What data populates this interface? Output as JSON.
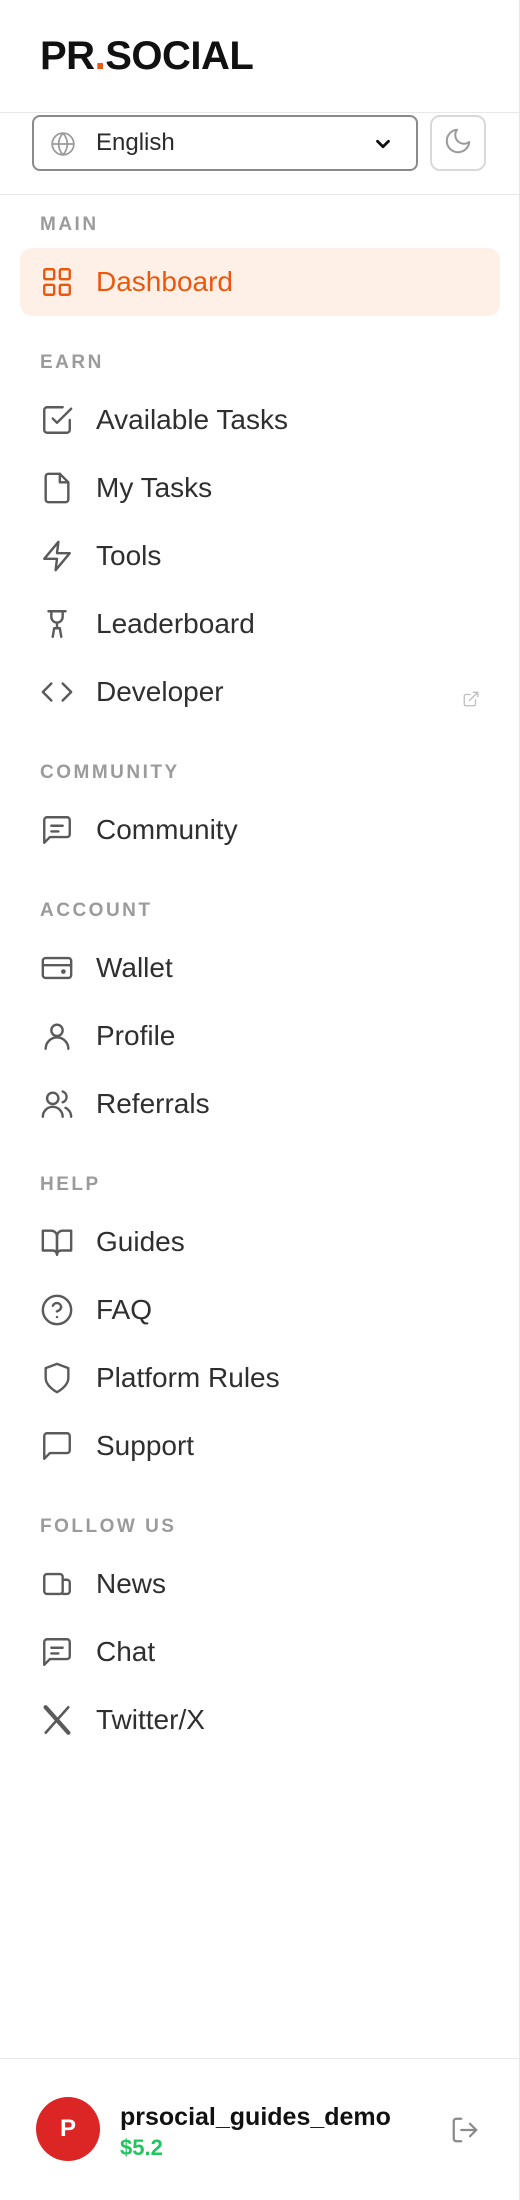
{
  "brand": {
    "left": "PR",
    "dot": ".",
    "right": "SOCIAL",
    "accent_color": "#ea580c"
  },
  "language": {
    "value": "English",
    "icon": "globe-icon"
  },
  "theme_toggle": {
    "icon": "moon-icon"
  },
  "sections": [
    {
      "label": "MAIN",
      "items": [
        {
          "label": "Dashboard",
          "icon": "dashboard-icon",
          "active": true
        }
      ]
    },
    {
      "label": "EARN",
      "items": [
        {
          "label": "Available Tasks",
          "icon": "checkbox-icon"
        },
        {
          "label": "My Tasks",
          "icon": "file-icon"
        },
        {
          "label": "Tools",
          "icon": "lightning-icon"
        },
        {
          "label": "Leaderboard",
          "icon": "trophy-icon"
        },
        {
          "label": "Developer",
          "icon": "code-icon",
          "external": true
        }
      ]
    },
    {
      "label": "COMMUNITY",
      "items": [
        {
          "label": "Community",
          "icon": "message-icon"
        }
      ]
    },
    {
      "label": "ACCOUNT",
      "items": [
        {
          "label": "Wallet",
          "icon": "wallet-icon"
        },
        {
          "label": "Profile",
          "icon": "user-icon"
        },
        {
          "label": "Referrals",
          "icon": "users-icon"
        }
      ]
    },
    {
      "label": "HELP",
      "items": [
        {
          "label": "Guides",
          "icon": "book-icon"
        },
        {
          "label": "FAQ",
          "icon": "help-circle-icon"
        },
        {
          "label": "Platform Rules",
          "icon": "shield-icon"
        },
        {
          "label": "Support",
          "icon": "chat-bubble-icon"
        }
      ]
    },
    {
      "label": "FOLLOW US",
      "items": [
        {
          "label": "News",
          "icon": "news-icon"
        },
        {
          "label": "Chat",
          "icon": "message-icon"
        },
        {
          "label": "Twitter/X",
          "icon": "x-logo-icon"
        }
      ]
    }
  ],
  "user": {
    "initial": "P",
    "username": "prsocial_guides_demo",
    "balance": "$5.2",
    "balance_color": "#22c55e",
    "avatar_color": "#dc2626"
  }
}
